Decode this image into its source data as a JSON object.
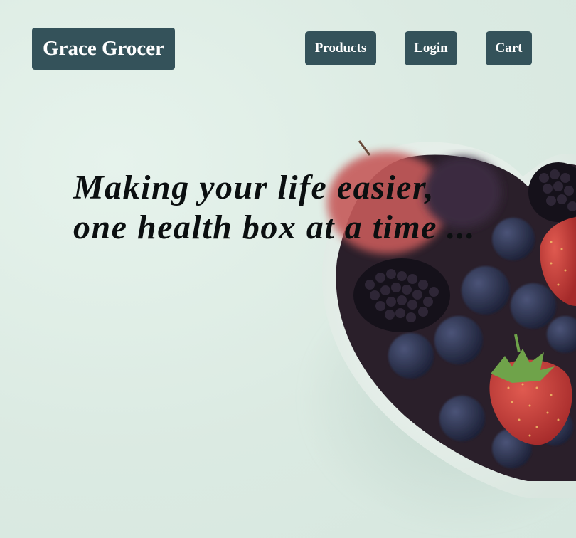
{
  "header": {
    "brand": "Grace Grocer",
    "nav": [
      {
        "label": "Products"
      },
      {
        "label": "Login"
      },
      {
        "label": "Cart"
      }
    ]
  },
  "hero": {
    "tagline_line1": "Making your life easier,",
    "tagline_line2": "one health box at a time ...",
    "image": "heart-bowl-of-berries"
  },
  "colors": {
    "button_bg": "#34525a",
    "button_text": "#ffffff",
    "page_bg": "#dcece4",
    "tagline_text": "#0b0f10"
  }
}
